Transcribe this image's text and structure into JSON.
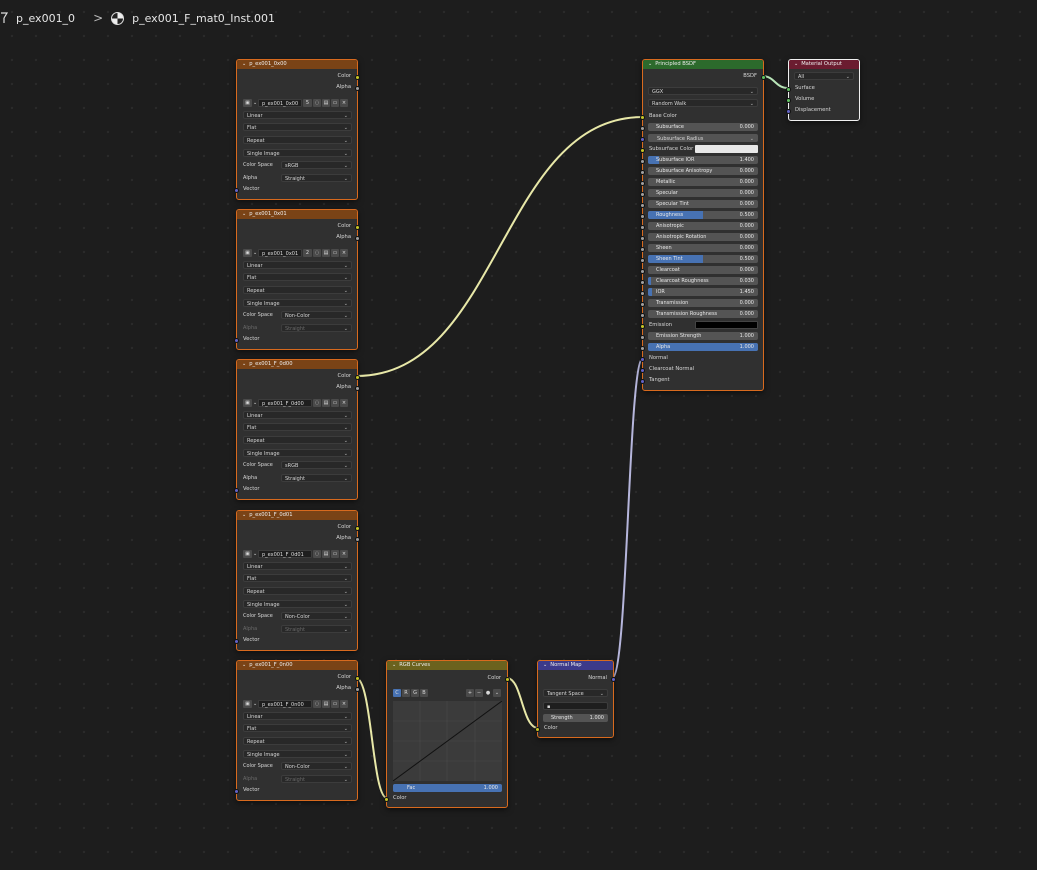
{
  "breadcrumb": {
    "object": "p_ex001_0",
    "material": "p_ex001_F_mat0_Inst.001"
  },
  "tex_nodes": [
    {
      "title": "p_ex001_0x00",
      "image_name": "p_ex001_0x00",
      "users": "5",
      "outputs": [
        "Color",
        "Alpha"
      ],
      "interpolation": "Linear",
      "projection": "Flat",
      "extension": "Repeat",
      "source": "Single Image",
      "color_space_label": "Color Space",
      "color_space": "sRGB",
      "alpha_label": "Alpha",
      "alpha": "Straight",
      "alpha_dim": false,
      "input": "Vector"
    },
    {
      "title": "p_ex001_0x01",
      "image_name": "p_ex001_0x01",
      "users": "2",
      "outputs": [
        "Color",
        "Alpha"
      ],
      "interpolation": "Linear",
      "projection": "Flat",
      "extension": "Repeat",
      "source": "Single Image",
      "color_space_label": "Color Space",
      "color_space": "Non-Color",
      "alpha_label": "Alpha",
      "alpha": "Straight",
      "alpha_dim": true,
      "input": "Vector"
    },
    {
      "title": "p_ex001_F_0d00",
      "image_name": "p_ex001_F_0d00",
      "users": "",
      "outputs": [
        "Color",
        "Alpha"
      ],
      "interpolation": "Linear",
      "projection": "Flat",
      "extension": "Repeat",
      "source": "Single Image",
      "color_space_label": "Color Space",
      "color_space": "sRGB",
      "alpha_label": "Alpha",
      "alpha": "Straight",
      "alpha_dim": false,
      "input": "Vector"
    },
    {
      "title": "p_ex001_F_0d01",
      "image_name": "p_ex001_F_0d01",
      "users": "",
      "outputs": [
        "Color",
        "Alpha"
      ],
      "interpolation": "Linear",
      "projection": "Flat",
      "extension": "Repeat",
      "source": "Single Image",
      "color_space_label": "Color Space",
      "color_space": "Non-Color",
      "alpha_label": "Alpha",
      "alpha": "Straight",
      "alpha_dim": true,
      "input": "Vector"
    },
    {
      "title": "p_ex001_F_0n00",
      "image_name": "p_ex001_F_0n00",
      "users": "",
      "outputs": [
        "Color",
        "Alpha"
      ],
      "interpolation": "Linear",
      "projection": "Flat",
      "extension": "Repeat",
      "source": "Single Image",
      "color_space_label": "Color Space",
      "color_space": "Non-Color",
      "alpha_label": "Alpha",
      "alpha": "Straight",
      "alpha_dim": true,
      "input": "Vector"
    }
  ],
  "bsdf": {
    "title": "Principled BSDF",
    "output": "BSDF",
    "distribution": "GGX",
    "subsurface_method": "Random Walk",
    "base_color_label": "Base Color",
    "subsurface_label": "Subsurface",
    "subsurface_value": "0.000",
    "subsurface_radius_label": "Subsurface Radius",
    "subsurface_color_label": "Subsurface Color",
    "sliders": [
      {
        "label": "Subsurface IOR",
        "value": "1.400",
        "fill": 0.1
      },
      {
        "label": "Subsurface Anisotropy",
        "value": "0.000",
        "fill": 0
      },
      {
        "label": "Metallic",
        "value": "0.000",
        "fill": 0
      },
      {
        "label": "Specular",
        "value": "0.000",
        "fill": 0
      },
      {
        "label": "Specular Tint",
        "value": "0.000",
        "fill": 0
      },
      {
        "label": "Roughness",
        "value": "0.500",
        "fill": 0.5
      },
      {
        "label": "Anisotropic",
        "value": "0.000",
        "fill": 0
      },
      {
        "label": "Anisotropic Rotation",
        "value": "0.000",
        "fill": 0
      },
      {
        "label": "Sheen",
        "value": "0.000",
        "fill": 0
      },
      {
        "label": "Sheen Tint",
        "value": "0.500",
        "fill": 0.5
      },
      {
        "label": "Clearcoat",
        "value": "0.000",
        "fill": 0
      },
      {
        "label": "Clearcoat Roughness",
        "value": "0.030",
        "fill": 0.03
      },
      {
        "label": "IOR",
        "value": "1.450",
        "fill": 0.04
      },
      {
        "label": "Transmission",
        "value": "0.000",
        "fill": 0
      },
      {
        "label": "Transmission Roughness",
        "value": "0.000",
        "fill": 0
      }
    ],
    "emission_label": "Emission",
    "emission_strength_label": "Emission Strength",
    "emission_strength_value": "1.000",
    "alpha_label": "Alpha",
    "alpha_value": "1.000",
    "normal_label": "Normal",
    "clearcoat_normal_label": "Clearcoat Normal",
    "tangent_label": "Tangent",
    "subsurface_color_hex": "#e8e8e8",
    "emission_color_hex": "#000000"
  },
  "material_output": {
    "title": "Material Output",
    "target": "All",
    "inputs": [
      "Surface",
      "Volume",
      "Displacement"
    ]
  },
  "rgb_curves": {
    "title": "RGB Curves",
    "output": "Color",
    "channels": [
      "C",
      "R",
      "G",
      "B"
    ],
    "fac_label": "Fac",
    "fac_value": "1.000",
    "input": "Color"
  },
  "normal_map": {
    "title": "Normal Map",
    "output": "Normal",
    "space": "Tangent Space",
    "uv_placeholder": "",
    "strength_label": "Strength",
    "strength_value": "1.000",
    "input": "Color"
  },
  "colors": {
    "texture_header": "#7a4316",
    "bsdf_header": "#2c6a2c",
    "output_header": "#6b1c30",
    "curves_header": "#6b621e",
    "vector_header": "#3d3a8a",
    "link_color": "#e8e8a8",
    "normal_link": "#b6b6dc",
    "selected_border": "#d86a1e"
  }
}
